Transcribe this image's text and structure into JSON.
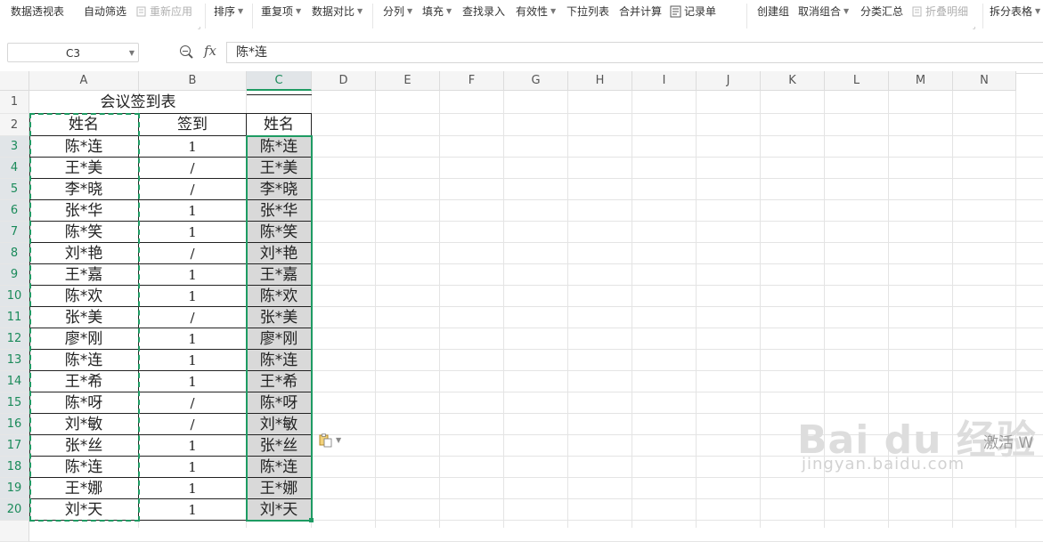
{
  "ribbon": {
    "items": [
      {
        "label": "数据透视表",
        "caret": false,
        "disabled": false
      },
      {
        "label": "自动筛选",
        "caret": false,
        "disabled": false
      },
      {
        "label": "重新应用",
        "caret": false,
        "disabled": true
      },
      {
        "label": "排序",
        "caret": true,
        "disabled": false
      },
      {
        "label": "重复项",
        "caret": true,
        "disabled": false
      },
      {
        "label": "数据对比",
        "caret": true,
        "disabled": false
      },
      {
        "label": "分列",
        "caret": true,
        "disabled": false
      },
      {
        "label": "填充",
        "caret": true,
        "disabled": false
      },
      {
        "label": "查找录入",
        "caret": false,
        "disabled": false
      },
      {
        "label": "有效性",
        "caret": true,
        "disabled": false
      },
      {
        "label": "下拉列表",
        "caret": false,
        "disabled": false
      },
      {
        "label": "合并计算",
        "caret": false,
        "disabled": false
      },
      {
        "label": "记录单",
        "caret": false,
        "disabled": false
      },
      {
        "label": "创建组",
        "caret": false,
        "disabled": false
      },
      {
        "label": "取消组合",
        "caret": true,
        "disabled": false
      },
      {
        "label": "分类汇总",
        "caret": false,
        "disabled": false
      },
      {
        "label": "折叠明细",
        "caret": false,
        "disabled": true
      },
      {
        "label": "拆分表格",
        "caret": true,
        "disabled": false
      }
    ]
  },
  "formula_bar": {
    "cell_ref": "C3",
    "fx_label": "fx",
    "value": "陈*连"
  },
  "columns": [
    "A",
    "B",
    "C",
    "D",
    "E",
    "F",
    "G",
    "H",
    "I",
    "J",
    "K",
    "L",
    "M",
    "N"
  ],
  "selected_column": "C",
  "sheet": {
    "title": "会议签到表",
    "headers": {
      "a": "姓名",
      "b": "签到",
      "c": "姓名"
    },
    "rows": [
      {
        "row": "3",
        "name": "陈*连",
        "sign": "1",
        "copy": "陈*连"
      },
      {
        "row": "4",
        "name": "王*美",
        "sign": "/",
        "copy": "王*美"
      },
      {
        "row": "5",
        "name": "李*晓",
        "sign": "/",
        "copy": "李*晓"
      },
      {
        "row": "6",
        "name": "张*华",
        "sign": "1",
        "copy": "张*华"
      },
      {
        "row": "7",
        "name": "陈*笑",
        "sign": "1",
        "copy": "陈*笑"
      },
      {
        "row": "8",
        "name": "刘*艳",
        "sign": "/",
        "copy": "刘*艳"
      },
      {
        "row": "9",
        "name": "王*嘉",
        "sign": "1",
        "copy": "王*嘉"
      },
      {
        "row": "10",
        "name": "陈*欢",
        "sign": "1",
        "copy": "陈*欢"
      },
      {
        "row": "11",
        "name": "张*美",
        "sign": "/",
        "copy": "张*美"
      },
      {
        "row": "12",
        "name": "廖*刚",
        "sign": "1",
        "copy": "廖*刚"
      },
      {
        "row": "13",
        "name": "陈*连",
        "sign": "1",
        "copy": "陈*连"
      },
      {
        "row": "14",
        "name": "王*希",
        "sign": "1",
        "copy": "王*希"
      },
      {
        "row": "15",
        "name": "陈*呀",
        "sign": "/",
        "copy": "陈*呀"
      },
      {
        "row": "16",
        "name": "刘*敏",
        "sign": "/",
        "copy": "刘*敏"
      },
      {
        "row": "17",
        "name": "张*丝",
        "sign": "1",
        "copy": "张*丝"
      },
      {
        "row": "18",
        "name": "陈*连",
        "sign": "1",
        "copy": "陈*连"
      },
      {
        "row": "19",
        "name": "王*娜",
        "sign": "1",
        "copy": "王*娜"
      },
      {
        "row": "20",
        "name": "刘*天",
        "sign": "1",
        "copy": "刘*天"
      }
    ]
  },
  "overlay": {
    "watermark": "Bai du 经验",
    "watermark_sub": "jingyan.baidu.com",
    "activate_text": "激活 W"
  }
}
